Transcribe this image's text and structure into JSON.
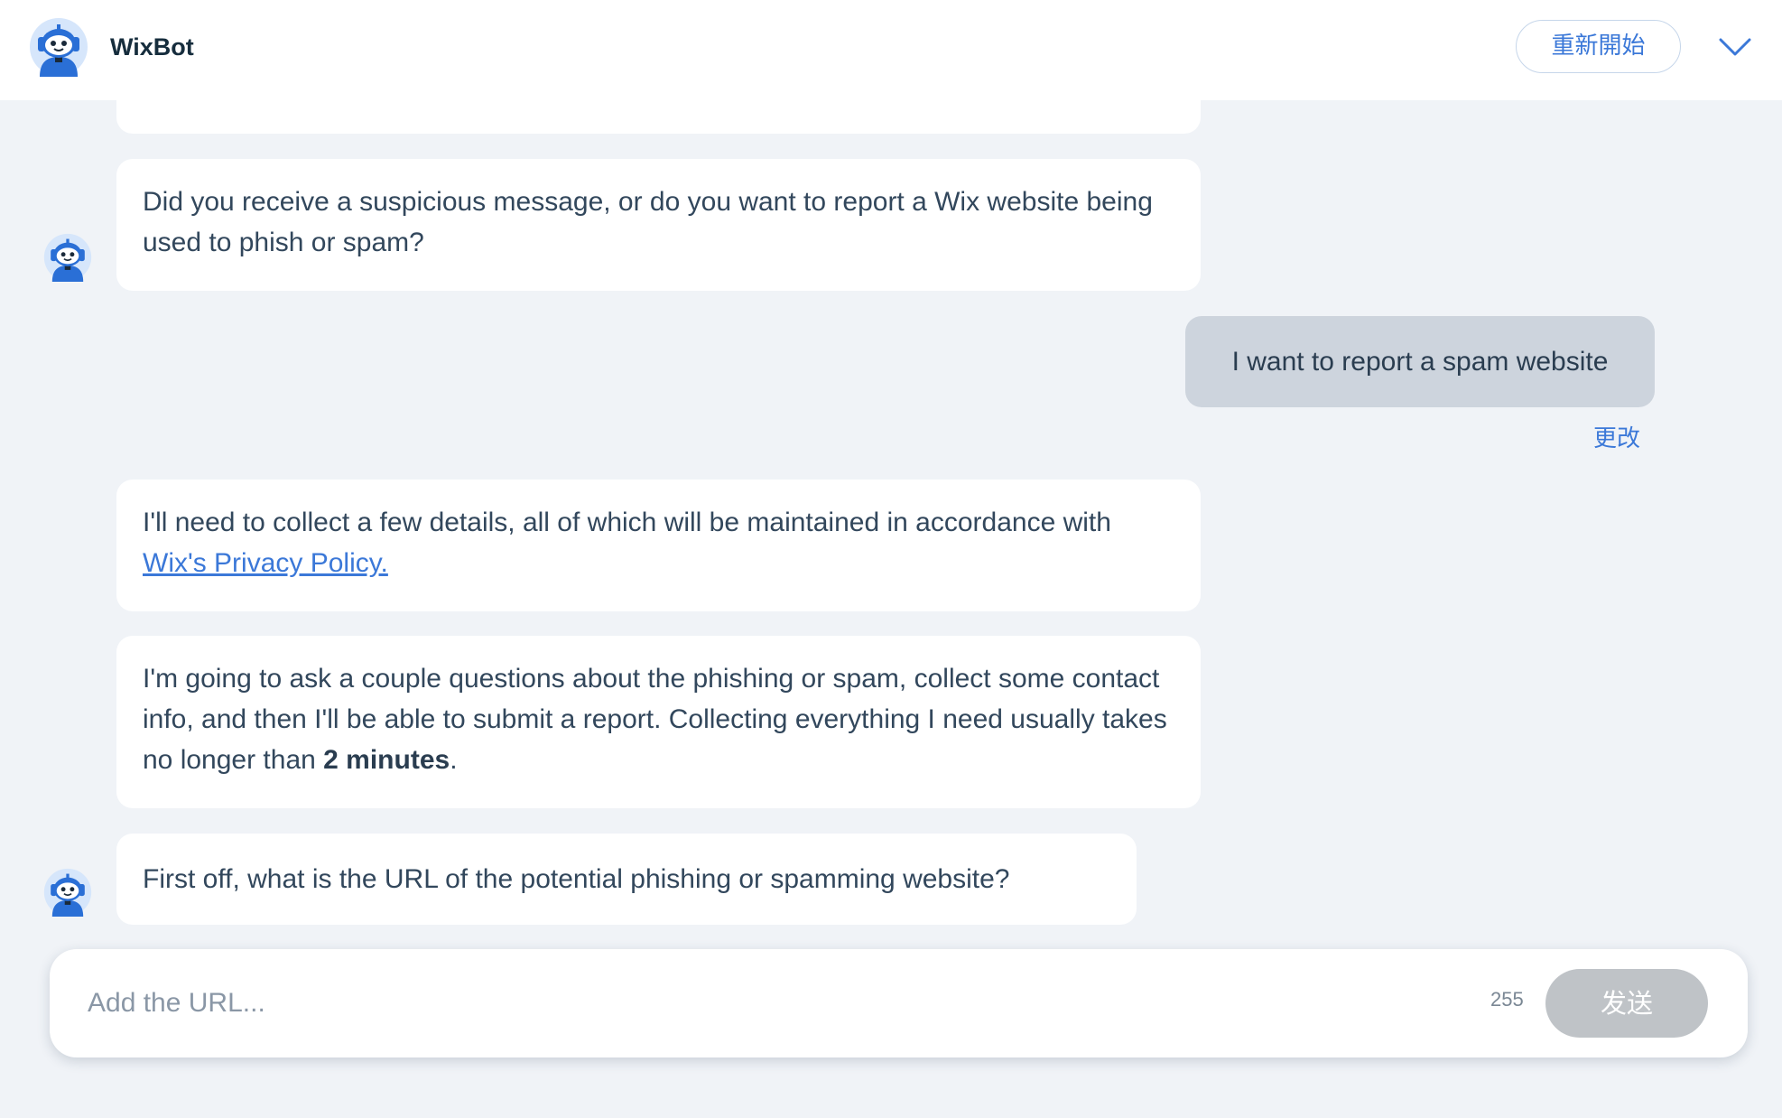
{
  "header": {
    "title": "WixBot",
    "restart_label": "重新開始",
    "avatar_icon": "robot-avatar-icon",
    "collapse_icon": "chevron-down-icon"
  },
  "conversation": {
    "bot_messages": {
      "m1": "Did you receive a suspicious message, or do you want to report a Wix website being used to phish or spam?",
      "m2_text": "I'll need to collect a few details, all of which will be maintained in accordance with ",
      "m2_link": "Wix's Privacy Policy.",
      "m3_text": "I'm going to ask a couple questions about the phishing or spam, collect some contact info, and then I'll be able to submit a report. Collecting everything I need usually takes no longer than ",
      "m3_bold": "2 minutes",
      "m3_end": ".",
      "m4": "First off, what is the URL of the potential phishing or spamming website?"
    },
    "user_message": "I want to report a spam website",
    "edit_label": "更改"
  },
  "composer": {
    "placeholder": "Add the URL...",
    "char_count": "255",
    "send_label": "发送"
  },
  "colors": {
    "accent": "#3b78d8",
    "background": "#f0f3f7",
    "user_bubble": "#cdd4dd",
    "send_disabled": "#bfc3c7"
  }
}
